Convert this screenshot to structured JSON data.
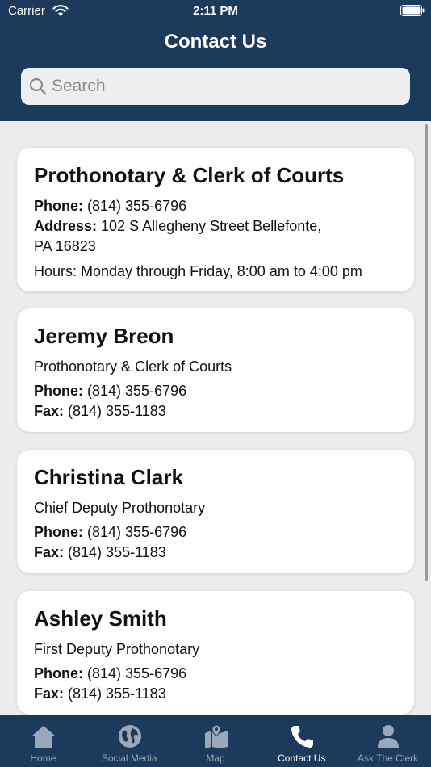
{
  "status_bar": {
    "carrier": "Carrier",
    "time": "2:11 PM"
  },
  "header": {
    "title": "Contact Us"
  },
  "search": {
    "placeholder": "Search",
    "value": ""
  },
  "cards": [
    {
      "title": "Prothonotary & Clerk of Courts",
      "phone_label": "Phone:",
      "phone": "(814) 355-6796",
      "address_label": "Address:",
      "address_line1": "102 S Allegheny Street Bellefonte,",
      "address_line2": "PA 16823",
      "hours": "Hours: Monday through Friday, 8:00 am to 4:00 pm"
    },
    {
      "title": "Jeremy Breon",
      "subtitle": "Prothonotary & Clerk of Courts",
      "phone_label": "Phone:",
      "phone": "(814) 355-6796",
      "fax_label": "Fax:",
      "fax": "(814) 355-1183"
    },
    {
      "title": "Christina Clark",
      "subtitle": "Chief Deputy Prothonotary",
      "phone_label": "Phone:",
      "phone": "(814) 355-6796",
      "fax_label": "Fax:",
      "fax": "(814) 355-1183"
    },
    {
      "title": "Ashley Smith",
      "subtitle": "First Deputy Prothonotary",
      "phone_label": "Phone:",
      "phone": "(814) 355-6796",
      "fax_label": "Fax:",
      "fax": "(814) 355-1183"
    }
  ],
  "tabs": [
    {
      "label": "Home",
      "icon": "home-icon"
    },
    {
      "label": "Social Media",
      "icon": "globe-icon"
    },
    {
      "label": "Map",
      "icon": "map-icon"
    },
    {
      "label": "Contact Us",
      "icon": "phone-icon",
      "active": true
    },
    {
      "label": "Ask The Clerk",
      "icon": "person-icon"
    }
  ],
  "colors": {
    "header_bg": "#1b3a5c",
    "active_tab": "#ffffff",
    "inactive_tab": "#9aa8b8",
    "content_bg": "#ececec"
  }
}
